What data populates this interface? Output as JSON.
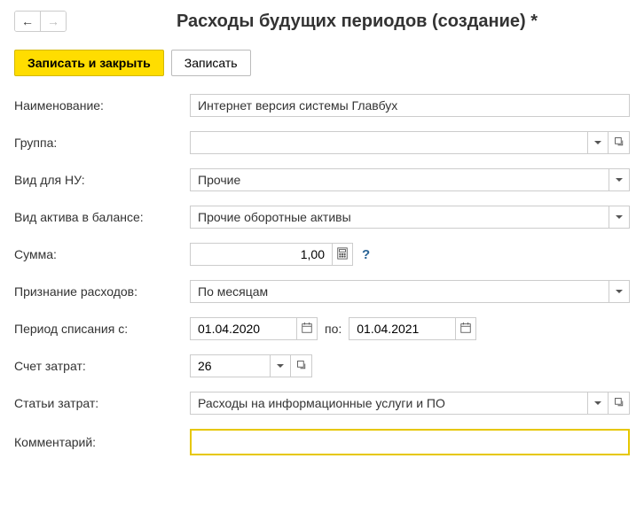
{
  "header": {
    "title": "Расходы будущих периодов (создание) *"
  },
  "toolbar": {
    "save_close_label": "Записать и закрыть",
    "save_label": "Записать"
  },
  "labels": {
    "name": "Наименование:",
    "group": "Группа:",
    "vid_nu": "Вид для НУ:",
    "vid_aktiva": "Вид актива в балансе:",
    "summa": "Сумма:",
    "priznanie": "Признание расходов:",
    "period": "Период списания с:",
    "po": "по:",
    "schet": "Счет затрат:",
    "stati": "Статьи затрат:",
    "comment": "Комментарий:"
  },
  "fields": {
    "name_value": "Интернет версия системы Главбух",
    "group_value": "",
    "vid_nu_value": "Прочие",
    "vid_aktiva_value": "Прочие оборотные активы",
    "summa_value": "1,00",
    "priznanie_value": "По месяцам",
    "date_from": "01.04.2020",
    "date_to": "01.04.2021",
    "schet_value": "26",
    "stati_value": "Расходы на информационные услуги и ПО",
    "comment_value": ""
  },
  "help": "?"
}
